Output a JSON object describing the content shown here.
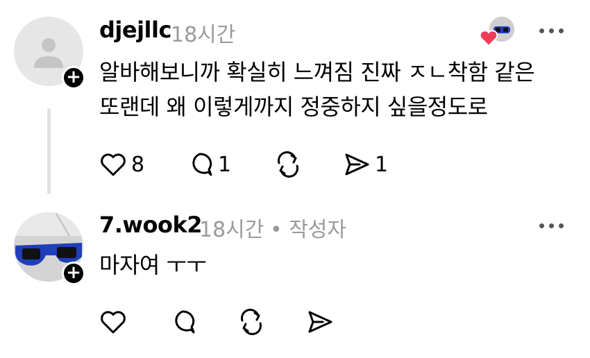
{
  "posts": [
    {
      "username": "djejllc",
      "time": "18시간",
      "author_tag": "",
      "lines": [
        "알바해보니까 확실히 느껴짐 진짜 ㅈㄴ착함 같은",
        "또랜데 왜 이렇게까지 정중하지 싶을정도로"
      ],
      "likes": "8",
      "replies": "1",
      "reposts": "",
      "shares": "1",
      "avatar_icon": "default-profile-icon"
    },
    {
      "username": "7.wook2",
      "time": "18시간",
      "author_tag": "• 작성자",
      "lines": [
        "마자여 ㅜㅜ"
      ],
      "likes": "",
      "replies": "",
      "reposts": "",
      "shares": "",
      "avatar_icon": "sunglasses-photo-icon"
    }
  ],
  "icons": {
    "like": "heart-outline-icon",
    "reply": "speech-bubble-icon",
    "repost": "repost-arrows-icon",
    "share": "send-arrow-icon",
    "more": "more-dots-icon",
    "follow": "plus-icon"
  },
  "colors": {
    "accent_heart": "#ef3d57",
    "muted_text": "#9a9a9a",
    "follow_badge": "#000000",
    "sunglasses_frame": "#1f3fb8"
  }
}
